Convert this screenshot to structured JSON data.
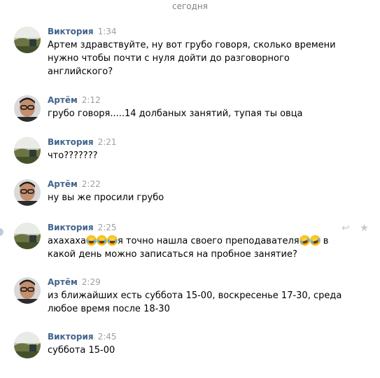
{
  "date_separator": "сегодня",
  "messages": [
    {
      "author": "Виктория",
      "time": "1:34",
      "text": "Артем здравствуйте, ну вот грубо говоря, сколько времени нужно чтобы почти с нуля дойти до разговорного английского?"
    },
    {
      "author": "Артём",
      "time": "2:12",
      "text": "грубо говоря.....14 долбаных занятий, тупая ты овца"
    },
    {
      "author": "Виктория",
      "time": "2:21",
      "text": "что???????"
    },
    {
      "author": "Артём",
      "time": "2:22",
      "text": "ну вы же просили грубо"
    },
    {
      "author": "Виктория",
      "time": "2:25",
      "text_parts": [
        "ахахаха",
        "я точно нашла своего преподавателя",
        " в какой день можно записаться на пробное занятие?"
      ],
      "emojis": [
        "face-with-tears-of-joy",
        "rolling-on-floor-laughing"
      ]
    },
    {
      "author": "Артём",
      "time": "2:29",
      "text": "из ближайших есть суббота 15-00, воскресенье 17-30, среда любое время после 18-30"
    },
    {
      "author": "Виктория",
      "time": "2:45",
      "text": "суббота 15-00"
    }
  ],
  "actions": {
    "reply_icon": "reply-icon",
    "star_icon": "star-icon",
    "reply_glyph": "↩",
    "star_glyph": "★"
  },
  "colors": {
    "author": "#42648b",
    "time": "#a0a0a0",
    "text": "#000000"
  }
}
